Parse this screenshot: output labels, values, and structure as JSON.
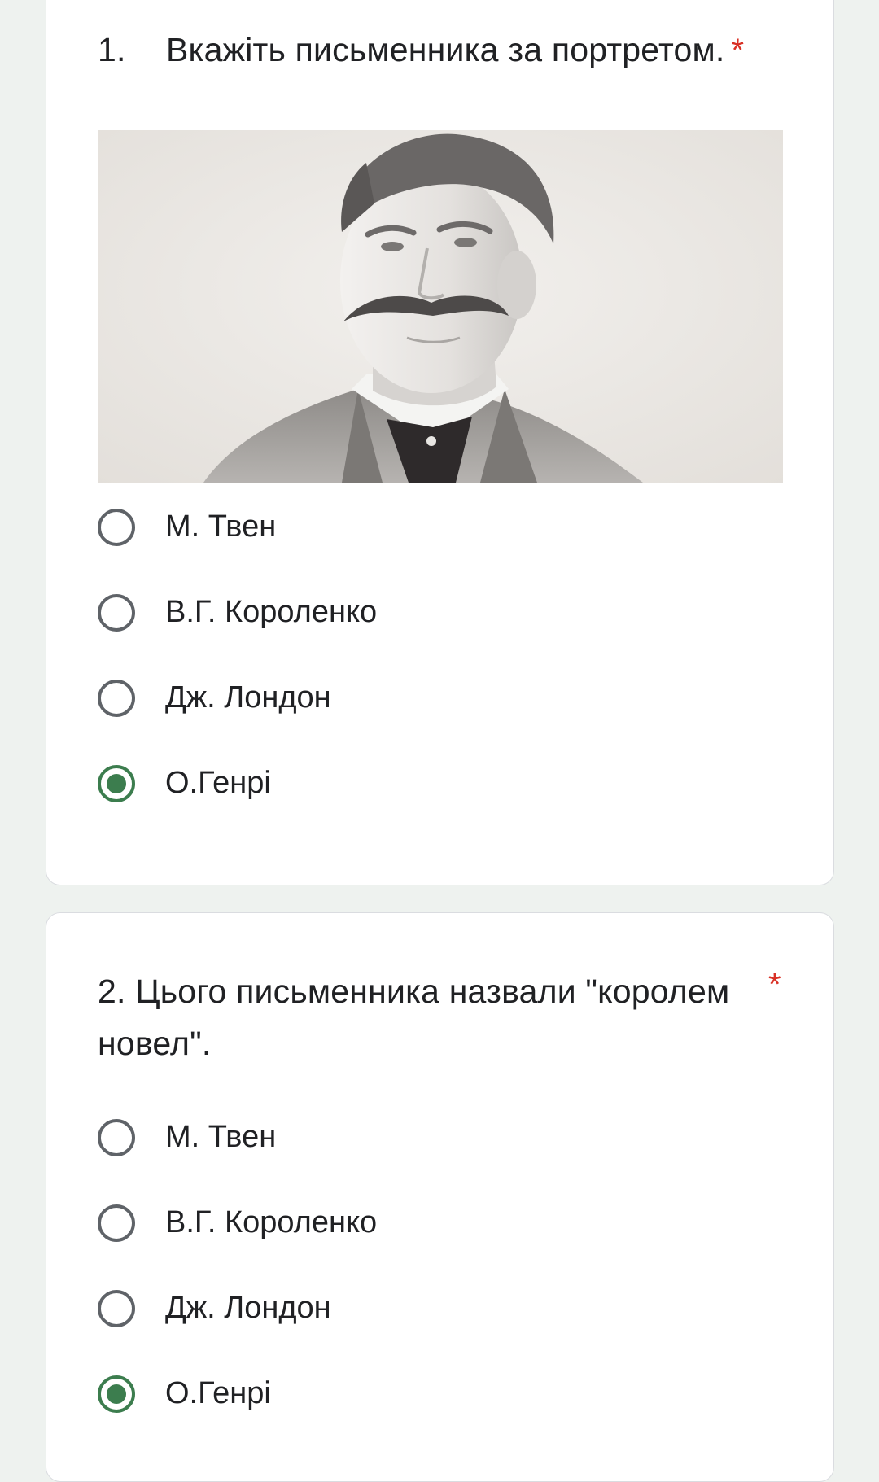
{
  "colors": {
    "page_background": "#eef2ef",
    "card_background": "#ffffff",
    "required_asterisk": "#d93025",
    "radio_selected": "#3c7d4e",
    "radio_unselected": "#5f6368"
  },
  "questions": [
    {
      "number": "1.",
      "text": "Вкажіть письменника за портретом.",
      "required_mark": "*",
      "image": "portrait-photo",
      "options": [
        {
          "label": "М. Твен",
          "selected": false
        },
        {
          "label": "В.Г. Короленко",
          "selected": false
        },
        {
          "label": "Дж. Лондон",
          "selected": false
        },
        {
          "label": "О.Генрі",
          "selected": true
        }
      ]
    },
    {
      "number": "2.",
      "text": "Цього письменника назвали \"королем новел\".",
      "required_mark": "*",
      "options": [
        {
          "label": "М. Твен",
          "selected": false
        },
        {
          "label": "В.Г. Короленко",
          "selected": false
        },
        {
          "label": "Дж. Лондон",
          "selected": false
        },
        {
          "label": "О.Генрі",
          "selected": true
        }
      ]
    }
  ]
}
